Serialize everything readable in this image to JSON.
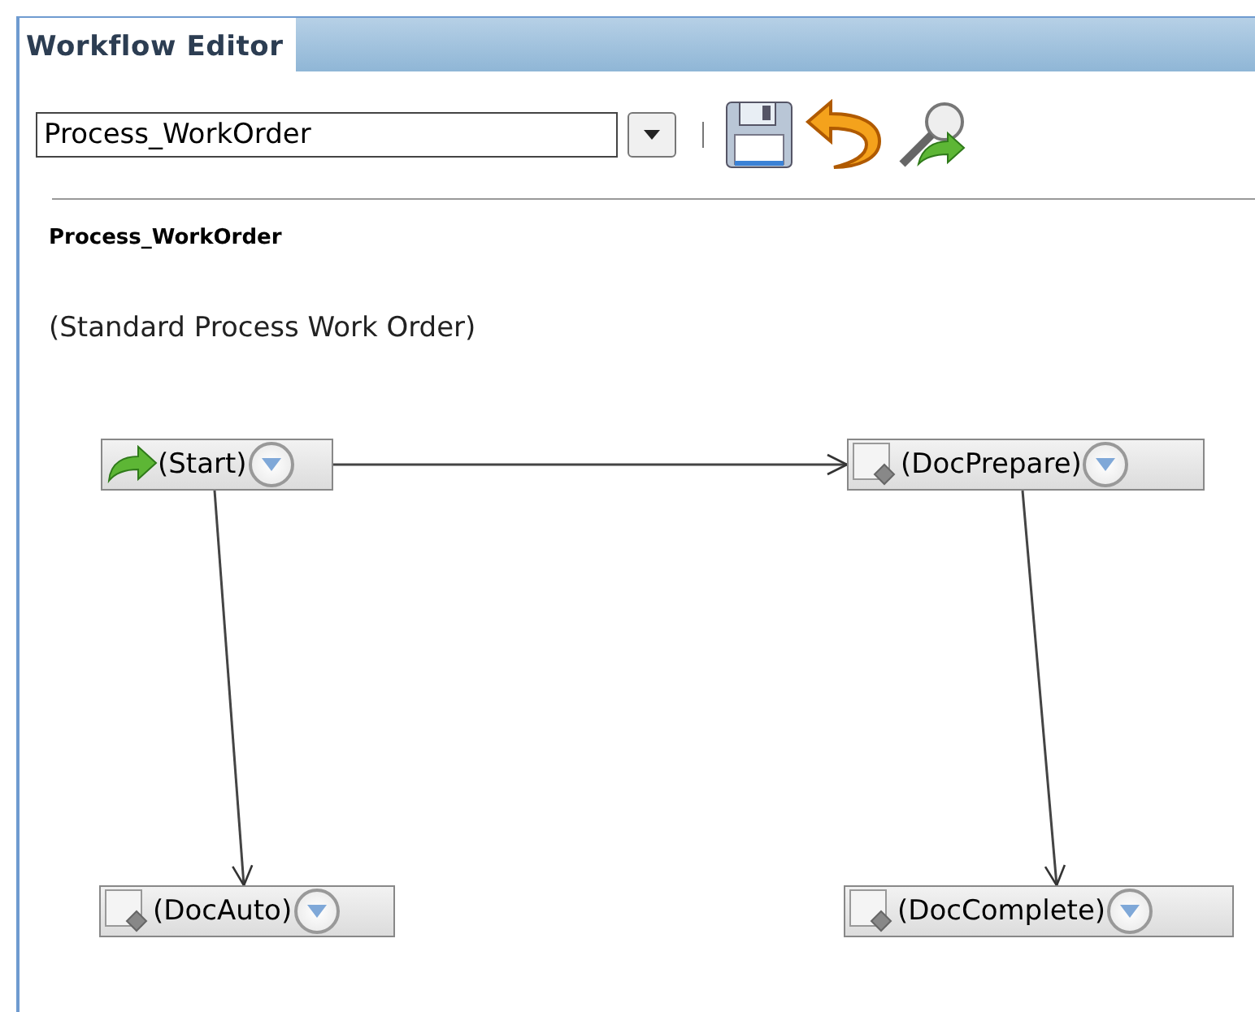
{
  "panel": {
    "title": "Workflow Editor"
  },
  "toolbar": {
    "workflow_select": "Process_WorkOrder"
  },
  "workflow": {
    "name": "Process_WorkOrder",
    "description": "(Standard Process Work Order)"
  },
  "nodes": [
    {
      "kind": "start",
      "label": "(Start)"
    },
    {
      "kind": "task",
      "label": "(DocPrepare)"
    },
    {
      "kind": "task",
      "label": "(DocAuto)"
    },
    {
      "kind": "task",
      "label": "(DocComplete)"
    }
  ]
}
